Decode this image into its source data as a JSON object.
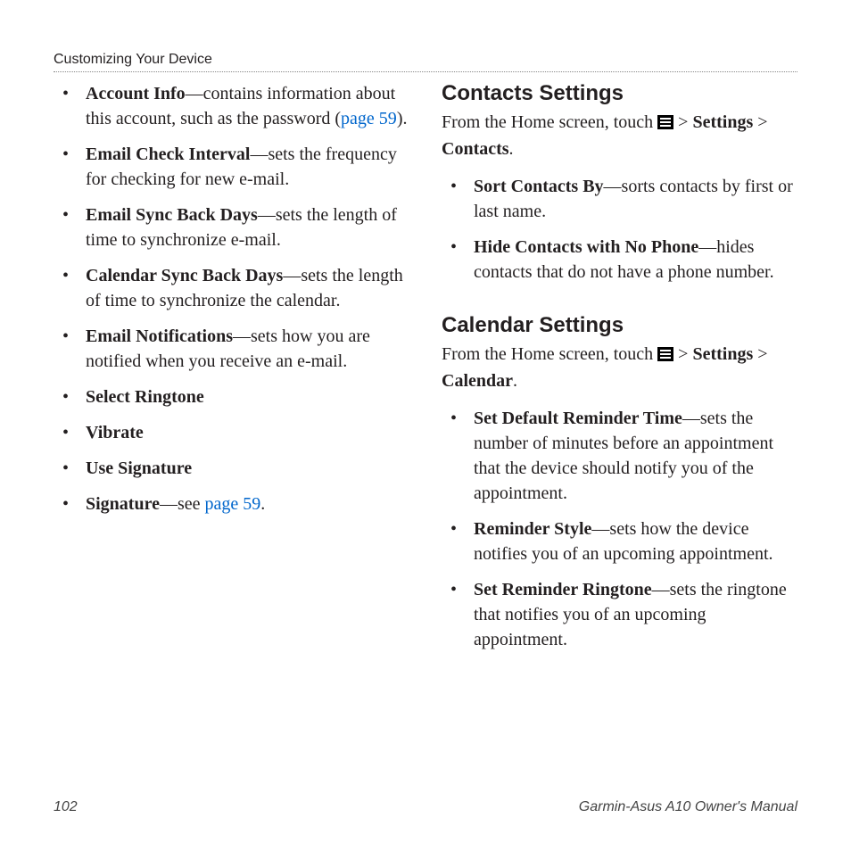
{
  "header": {
    "running_head": "Customizing Your Device"
  },
  "left": {
    "items": [
      {
        "term": "Account Info",
        "desc": "—contains information about this account, such as the password (",
        "link": "page 59",
        "tail": ")."
      },
      {
        "term": "Email Check Interval",
        "desc": "—sets the frequency for checking for new e-mail."
      },
      {
        "term": "Email Sync Back Days",
        "desc": "—sets the length of time to synchronize e-mail."
      },
      {
        "term": "Calendar Sync Back Days",
        "desc": "—sets the length of time to synchronize the calendar."
      },
      {
        "term": "Email Notifications",
        "desc": "—sets how you are notified when you receive an e-mail."
      },
      {
        "term": "Select Ringtone",
        "desc": ""
      },
      {
        "term": "Vibrate",
        "desc": ""
      },
      {
        "term": "Use Signature",
        "desc": ""
      },
      {
        "term": "Signature",
        "desc": "—see ",
        "link": "page 59",
        "tail": "."
      }
    ]
  },
  "right": {
    "contacts": {
      "heading": "Contacts Settings",
      "intro_prefix": "From the Home screen, touch ",
      "intro_suffix": " > ",
      "nav1": "Settings",
      "nav_sep": " > ",
      "nav2": "Contacts",
      "nav_tail": ".",
      "items": [
        {
          "term": "Sort Contacts By",
          "desc": "—sorts contacts by first or last name."
        },
        {
          "term": "Hide Contacts with No Phone",
          "desc": "—hides contacts that do not have a phone number."
        }
      ]
    },
    "calendar": {
      "heading": "Calendar Settings",
      "intro_prefix": "From the Home screen, touch ",
      "intro_suffix": " > ",
      "nav1": "Settings",
      "nav_sep": " > ",
      "nav2": "Calendar",
      "nav_tail": ".",
      "items": [
        {
          "term": "Set Default Reminder Time",
          "desc": "—sets the number of minutes before an appointment that the device should notify you of the appointment."
        },
        {
          "term": "Reminder Style",
          "desc": "—sets how the device notifies you of an upcoming appointment."
        },
        {
          "term": "Set Reminder Ringtone",
          "desc": "—sets the ringtone that notifies you of an upcoming appointment."
        }
      ]
    }
  },
  "footer": {
    "page_number": "102",
    "book_title": "Garmin-Asus A10 Owner's Manual"
  }
}
